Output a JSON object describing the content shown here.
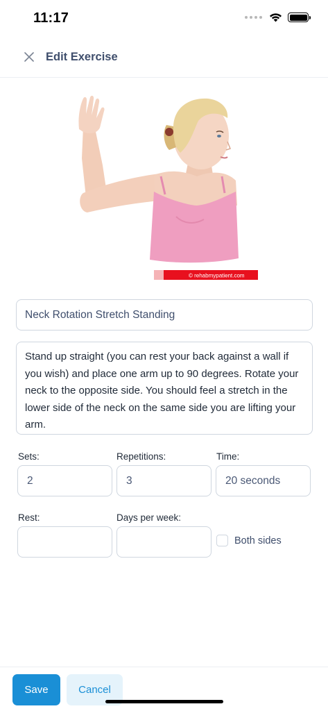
{
  "status_bar": {
    "time": "11:17"
  },
  "header": {
    "title": "Edit Exercise",
    "close_icon": "close-icon"
  },
  "exercise_image": {
    "watermark": "© rehabmypatient.com"
  },
  "form": {
    "name": "Neck Rotation Stretch Standing",
    "description": "Stand up straight (you can rest your back against a wall if you wish) and place one arm up to 90 degrees. Rotate your neck to the opposite side. You should feel a stretch in the lower side of the neck on the same side you are lifting your arm.",
    "sets_label": "Sets:",
    "sets_value": "2",
    "repetitions_label": "Repetitions:",
    "repetitions_value": "3",
    "time_label": "Time:",
    "time_value": "20 seconds",
    "rest_label": "Rest:",
    "rest_value": "",
    "days_label": "Days per week:",
    "days_value": "",
    "both_sides_label": "Both sides",
    "both_sides_checked": false
  },
  "footer": {
    "save_label": "Save",
    "cancel_label": "Cancel"
  },
  "colors": {
    "primary": "#1a8fd6",
    "primary_light": "#e5f3fb",
    "title": "#3f4e6c",
    "border": "#cfd6df"
  }
}
